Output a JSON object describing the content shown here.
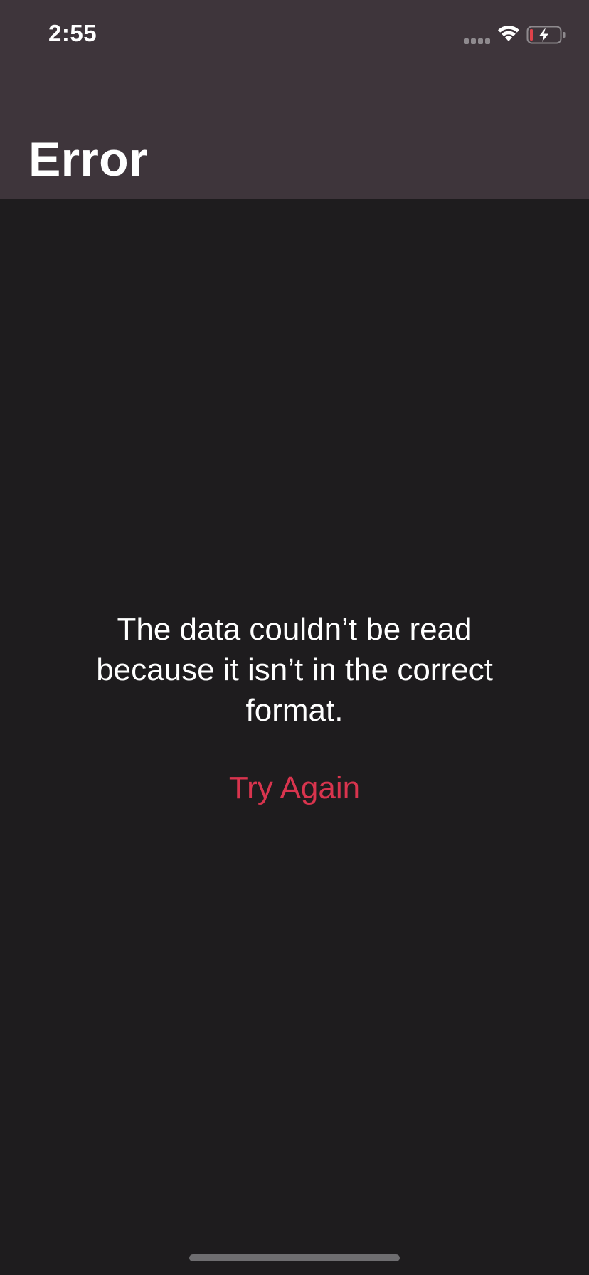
{
  "status_bar": {
    "time": "2:55",
    "icons": [
      "signal-icon",
      "wifi-icon",
      "battery-charging-icon"
    ]
  },
  "navigation": {
    "title": "Error"
  },
  "error": {
    "message": "The data couldn’t be read because it isn’t in the correct format.",
    "retry_label": "Try Again"
  },
  "colors": {
    "header_background": "#3e353b",
    "content_background": "#1e1c1e",
    "accent": "#d9344e",
    "text": "#ffffff",
    "battery_low": "#e0424a"
  }
}
